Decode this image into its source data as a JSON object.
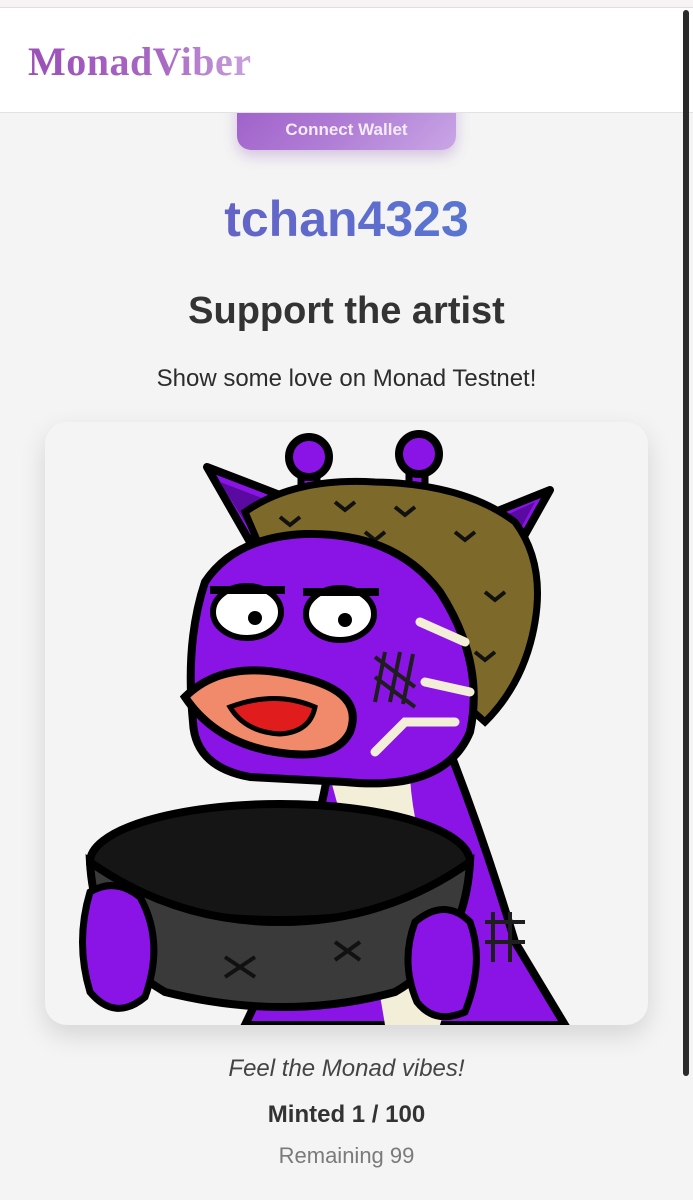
{
  "header": {
    "logo": "MonadViber"
  },
  "wallet": {
    "connect_label": "Connect Wallet"
  },
  "profile": {
    "username": "tchan4323"
  },
  "support": {
    "title": "Support the artist",
    "subtitle": "Show some love on Monad Testnet!"
  },
  "nft": {
    "image_icon": "purple-giraffe-holding-bowl-illustration",
    "tagline": "Feel the Monad vibes!",
    "minted_label": "Minted 1 / 100",
    "remaining_label": "Remaining 99"
  },
  "colors": {
    "accent": "#9d5bc8",
    "username_gradient_end": "#4d86d8"
  }
}
